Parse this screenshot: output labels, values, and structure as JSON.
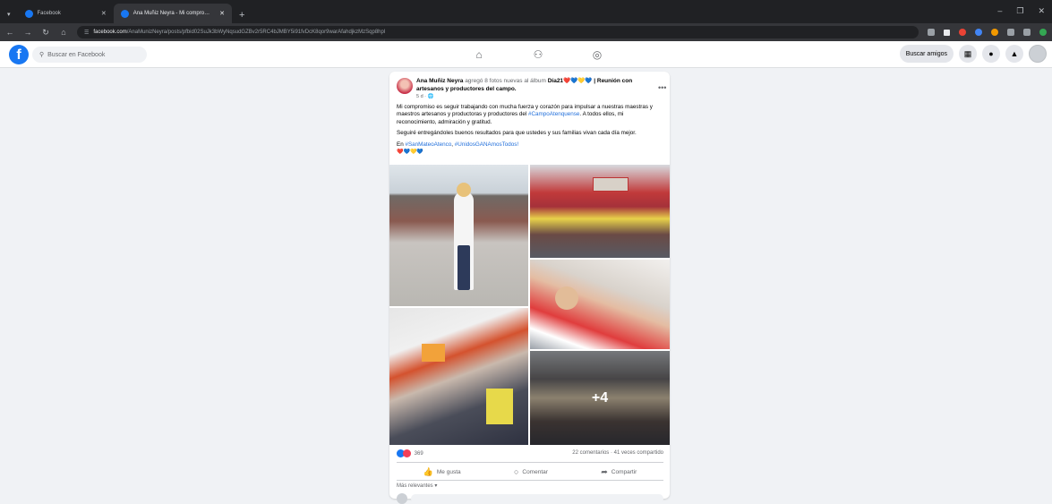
{
  "browser": {
    "tabs": [
      {
        "title": "Facebook",
        "active": false
      },
      {
        "title": "Ana Muñiz Neyra - Mi compro…",
        "active": true
      }
    ],
    "new_tab_label": "+",
    "url_domain": "facebook.com",
    "url_path": "/AnaMunizNeyra/posts/pfbid02SuJk3bWyNqsudGZBv2r5RC4bJMBY5i91fvDcK8qor9warAfahdjkzMzSqp8hpl"
  },
  "facebook": {
    "logo_letter": "f",
    "search_placeholder": "Buscar en Facebook",
    "find_friends_label": "Buscar amigos"
  },
  "post": {
    "author": "Ana Muñiz Neyra",
    "added_text": "agregó 8 fotos nuevas al álbum",
    "album_prefix": "Día21",
    "album_hearts": "❤️💙💛💙",
    "album_suffix": "| Reunión con artesanos y productores del campo.",
    "time": "5 d · ",
    "globe_icon": "🌐",
    "paragraph1_a": "Mi compromiso es seguir trabajando con mucha fuerza y corazón para impulsar a nuestras maestras y maestros artesanos y productoras y productores del ",
    "paragraph1_tag": "#CampoAtenquense",
    "paragraph1_b": ". A todos ellos, mi reconocimiento, admiración y gratitud.",
    "paragraph2": "Seguiré entregándoles buenos resultados para que ustedes y sus familias vivan cada día mejor.",
    "paragraph3_a": "En ",
    "paragraph3_tag1": "#SanMateoAtenco",
    "paragraph3_sep": ", ",
    "paragraph3_tag2a": "#UnidosGANA",
    "paragraph3_tag2b": "mosTodos!",
    "hearts_line": "❤️💙💛💙",
    "more_photos": "+4",
    "reaction_count": "369",
    "comments_shares": "22 comentarios · 41 veces compartido",
    "like_label": "Me gusta",
    "comment_label": "Comentar",
    "share_label": "Compartir",
    "sort_label": "Más relevantes ▾"
  }
}
